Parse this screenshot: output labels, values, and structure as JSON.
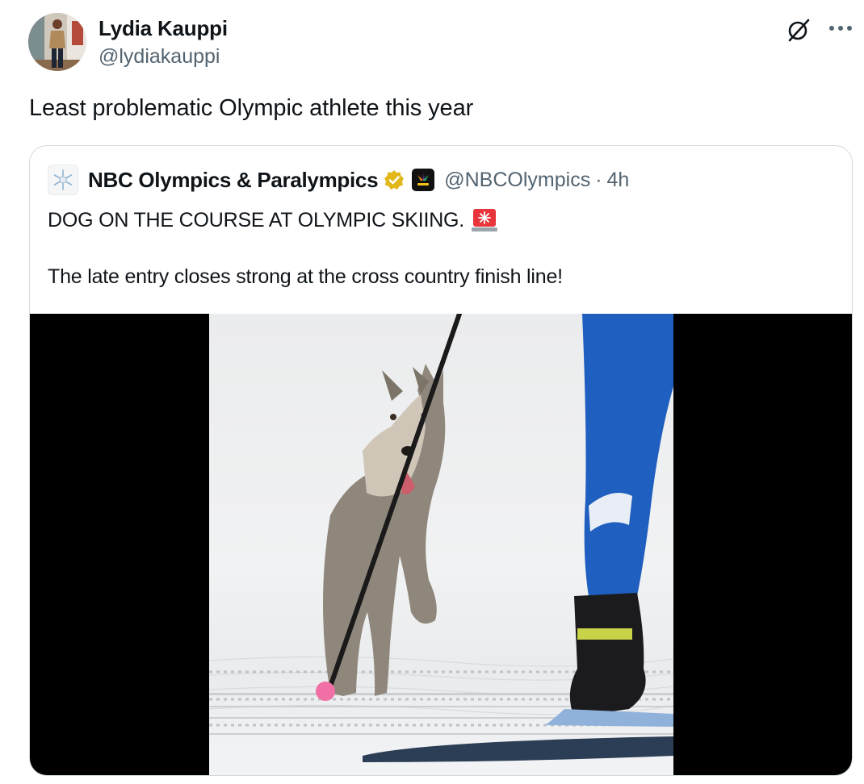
{
  "author": {
    "name": "Lydia Kauppi",
    "handle": "@lydiakauppi"
  },
  "tweet": {
    "text": "Least problematic Olympic athlete this year"
  },
  "icons": {
    "grok": "grok-icon",
    "more": "more-horizontal-icon"
  },
  "quote": {
    "name": "NBC Olympics & Paralympics",
    "verified_color": "#e2b719",
    "handle": "@NBCOlympics",
    "separator": "·",
    "time": "4h",
    "line1": "DOG ON THE COURSE AT OLYMPIC SKIING.",
    "line2": "The late entry closes strong at the cross country finish line!"
  },
  "colors": {
    "text_primary": "#0f1419",
    "text_secondary": "#536471",
    "border": "#cfd9de",
    "skier_blue": "#1f5fbf"
  }
}
